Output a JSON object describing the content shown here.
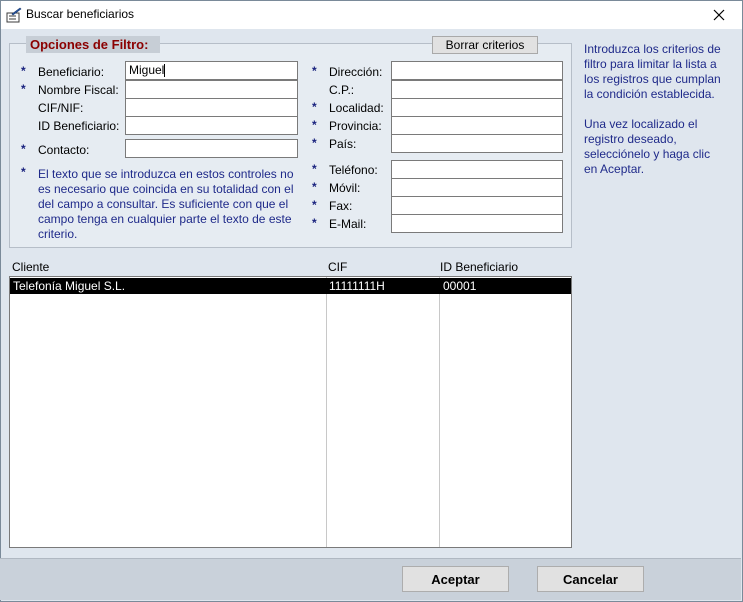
{
  "window": {
    "title": "Buscar beneficiarios"
  },
  "filter": {
    "legend": "Opciones de Filtro:",
    "clear_button": "Borrar criterios",
    "left_fields": [
      {
        "label": "Beneficiario:",
        "value": "Miguel"
      },
      {
        "label": "Nombre Fiscal:",
        "value": ""
      },
      {
        "label": "CIF/NIF:",
        "value": ""
      },
      {
        "label": "ID Beneficiario:",
        "value": ""
      },
      {
        "label": "Contacto:",
        "value": ""
      }
    ],
    "right_fields": [
      {
        "label": "Dirección:",
        "value": ""
      },
      {
        "label": "C.P.:",
        "value": ""
      },
      {
        "label": "Localidad:",
        "value": ""
      },
      {
        "label": "Provincia:",
        "value": ""
      },
      {
        "label": "País:",
        "value": ""
      },
      {
        "label": "Teléfono:",
        "value": ""
      },
      {
        "label": "Móvil:",
        "value": ""
      },
      {
        "label": "Fax:",
        "value": ""
      },
      {
        "label": "E-Mail:",
        "value": ""
      }
    ],
    "note": "El texto que se introduzca en estos controles no es necesario que coincida en su totalidad con el del campo a consultar. Es suficiente con que el campo tenga en cualquier parte el texto de este criterio."
  },
  "help": {
    "para1": "Introduzca los criterios de filtro para limitar la lista a los registros que cumplan la condición establecida.",
    "para2": "Una vez localizado el registro deseado, selecciónelo y haga clic en Aceptar."
  },
  "grid": {
    "columns": [
      "Cliente",
      "CIF",
      "ID Beneficiario"
    ],
    "rows": [
      {
        "cliente": "Telefonía Miguel S.L.",
        "cif": "11111111H",
        "id": "00001"
      }
    ]
  },
  "buttons": {
    "accept": "Aceptar",
    "cancel": "Cancelar"
  },
  "icons": {
    "app": "edit-document-icon",
    "close": "close-icon",
    "star": "asterisk-icon"
  }
}
